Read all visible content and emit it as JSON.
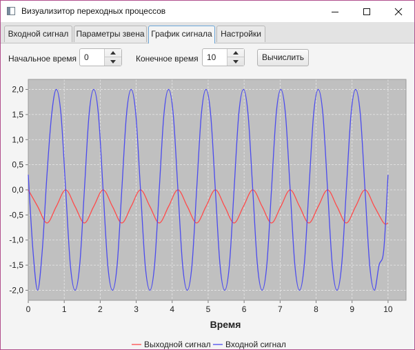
{
  "window": {
    "title": "Визуализитор переходных процессов"
  },
  "tabs": [
    {
      "label": "Входной сигнал"
    },
    {
      "label": "Параметры звена"
    },
    {
      "label": "График сигнала"
    },
    {
      "label": "Настройки"
    }
  ],
  "controls": {
    "start_label": "Начальное время",
    "start_value": "0",
    "end_label": "Конечное время",
    "end_value": "10",
    "compute_label": "Вычислить"
  },
  "chart_data": {
    "type": "line",
    "title": "",
    "xlabel": "Время",
    "ylabel": "",
    "xlim": [
      0,
      10.5
    ],
    "ylim": [
      -2.2,
      2.2
    ],
    "x_ticks": [
      "0",
      "1",
      "2",
      "3",
      "4",
      "5",
      "6",
      "7",
      "8",
      "9",
      "10"
    ],
    "y_ticks": [
      "2,0",
      "1,5",
      "1,0",
      "0,5",
      "0,0",
      "-0,5",
      "-1,0",
      "-1,5",
      "-2,0"
    ],
    "grid": true,
    "legend_position": "bottom",
    "colors": {
      "plot_bg": "#c0c0c0",
      "output": "#ff4a4a",
      "input": "#4a4aee"
    },
    "series": [
      {
        "name": "Выходной сигнал",
        "x": [
          0,
          0.26,
          0.52,
          0.78,
          1.04,
          1.3,
          1.56,
          1.82,
          2.08,
          2.34,
          2.6,
          2.86,
          3.12,
          3.38,
          3.64,
          3.9,
          4.16,
          4.42,
          4.68,
          4.94,
          5.2,
          5.46,
          5.72,
          5.98,
          6.24,
          6.5,
          6.76,
          7.02,
          7.28,
          7.54,
          7.8,
          8.06,
          8.32,
          8.58,
          8.84,
          9.1,
          9.36,
          9.62,
          9.88,
          10
        ],
        "values": [
          0.0,
          -0.33,
          -0.66,
          -0.33,
          0.0,
          -0.33,
          -0.66,
          -0.33,
          0.0,
          -0.33,
          -0.66,
          -0.33,
          0.0,
          -0.33,
          -0.66,
          -0.33,
          0.0,
          -0.33,
          -0.66,
          -0.33,
          0.0,
          -0.33,
          -0.66,
          -0.33,
          0.0,
          -0.33,
          -0.66,
          -0.33,
          0.0,
          -0.33,
          -0.66,
          -0.33,
          0.0,
          -0.33,
          -0.66,
          -0.33,
          0.0,
          -0.33,
          -0.66,
          -0.66
        ]
      },
      {
        "name": "Входной сигнал",
        "x": [
          0,
          0.13,
          0.26,
          0.39,
          0.52,
          0.65,
          0.78,
          0.91,
          1.04,
          1.17,
          1.3,
          1.43,
          1.56,
          1.69,
          1.82,
          1.95,
          2.08,
          2.21,
          2.34,
          2.47,
          2.6,
          2.73,
          2.86,
          2.99,
          3.12,
          3.25,
          3.38,
          3.51,
          3.64,
          3.77,
          3.9,
          4.03,
          4.16,
          4.29,
          4.42,
          4.55,
          4.68,
          4.81,
          4.94,
          5.07,
          5.2,
          5.33,
          5.46,
          5.59,
          5.72,
          5.85,
          5.98,
          6.11,
          6.24,
          6.37,
          6.5,
          6.63,
          6.76,
          6.89,
          7.02,
          7.15,
          7.28,
          7.41,
          7.54,
          7.67,
          7.8,
          7.93,
          8.06,
          8.19,
          8.32,
          8.45,
          8.58,
          8.71,
          8.84,
          8.97,
          9.1,
          9.23,
          9.36,
          9.49,
          9.62,
          9.75,
          9.88,
          10
        ],
        "values": [
          0.3,
          -1.2,
          -2.0,
          -1.2,
          0.3,
          1.5,
          2.0,
          1.5,
          0.0,
          -1.5,
          -2.0,
          -1.5,
          0.0,
          1.5,
          2.0,
          1.5,
          0.0,
          -1.5,
          -2.0,
          -1.5,
          0.0,
          1.5,
          2.0,
          1.5,
          0.0,
          -1.5,
          -2.0,
          -1.5,
          0.0,
          1.5,
          2.0,
          1.5,
          0.0,
          -1.5,
          -2.0,
          -1.5,
          0.0,
          1.5,
          2.0,
          1.5,
          0.0,
          -1.5,
          -2.0,
          -1.5,
          0.0,
          1.5,
          2.0,
          1.5,
          0.0,
          -1.5,
          -2.0,
          -1.5,
          0.0,
          1.5,
          2.0,
          1.5,
          0.0,
          -1.5,
          -2.0,
          -1.5,
          0.0,
          1.5,
          2.0,
          1.5,
          0.0,
          -1.5,
          -2.0,
          -1.5,
          0.0,
          1.5,
          2.0,
          1.5,
          0.0,
          -1.5,
          -2.0,
          -1.5,
          -1.2,
          0.3
        ]
      }
    ]
  }
}
